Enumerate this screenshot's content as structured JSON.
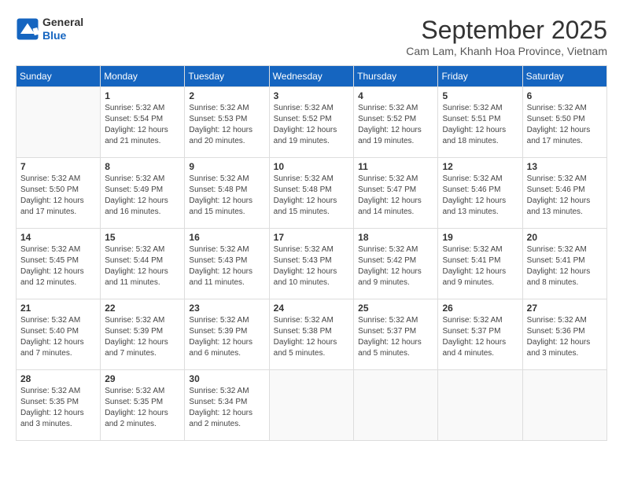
{
  "logo": {
    "line1": "General",
    "line2": "Blue"
  },
  "title": "September 2025",
  "subtitle": "Cam Lam, Khanh Hoa Province, Vietnam",
  "days_of_week": [
    "Sunday",
    "Monday",
    "Tuesday",
    "Wednesday",
    "Thursday",
    "Friday",
    "Saturday"
  ],
  "weeks": [
    [
      {
        "day": null
      },
      {
        "day": 1,
        "sunrise": "5:32 AM",
        "sunset": "5:54 PM",
        "daylight": "12 hours and 21 minutes."
      },
      {
        "day": 2,
        "sunrise": "5:32 AM",
        "sunset": "5:53 PM",
        "daylight": "12 hours and 20 minutes."
      },
      {
        "day": 3,
        "sunrise": "5:32 AM",
        "sunset": "5:52 PM",
        "daylight": "12 hours and 19 minutes."
      },
      {
        "day": 4,
        "sunrise": "5:32 AM",
        "sunset": "5:52 PM",
        "daylight": "12 hours and 19 minutes."
      },
      {
        "day": 5,
        "sunrise": "5:32 AM",
        "sunset": "5:51 PM",
        "daylight": "12 hours and 18 minutes."
      },
      {
        "day": 6,
        "sunrise": "5:32 AM",
        "sunset": "5:50 PM",
        "daylight": "12 hours and 17 minutes."
      }
    ],
    [
      {
        "day": 7,
        "sunrise": "5:32 AM",
        "sunset": "5:50 PM",
        "daylight": "12 hours and 17 minutes."
      },
      {
        "day": 8,
        "sunrise": "5:32 AM",
        "sunset": "5:49 PM",
        "daylight": "12 hours and 16 minutes."
      },
      {
        "day": 9,
        "sunrise": "5:32 AM",
        "sunset": "5:48 PM",
        "daylight": "12 hours and 15 minutes."
      },
      {
        "day": 10,
        "sunrise": "5:32 AM",
        "sunset": "5:48 PM",
        "daylight": "12 hours and 15 minutes."
      },
      {
        "day": 11,
        "sunrise": "5:32 AM",
        "sunset": "5:47 PM",
        "daylight": "12 hours and 14 minutes."
      },
      {
        "day": 12,
        "sunrise": "5:32 AM",
        "sunset": "5:46 PM",
        "daylight": "12 hours and 13 minutes."
      },
      {
        "day": 13,
        "sunrise": "5:32 AM",
        "sunset": "5:46 PM",
        "daylight": "12 hours and 13 minutes."
      }
    ],
    [
      {
        "day": 14,
        "sunrise": "5:32 AM",
        "sunset": "5:45 PM",
        "daylight": "12 hours and 12 minutes."
      },
      {
        "day": 15,
        "sunrise": "5:32 AM",
        "sunset": "5:44 PM",
        "daylight": "12 hours and 11 minutes."
      },
      {
        "day": 16,
        "sunrise": "5:32 AM",
        "sunset": "5:43 PM",
        "daylight": "12 hours and 11 minutes."
      },
      {
        "day": 17,
        "sunrise": "5:32 AM",
        "sunset": "5:43 PM",
        "daylight": "12 hours and 10 minutes."
      },
      {
        "day": 18,
        "sunrise": "5:32 AM",
        "sunset": "5:42 PM",
        "daylight": "12 hours and 9 minutes."
      },
      {
        "day": 19,
        "sunrise": "5:32 AM",
        "sunset": "5:41 PM",
        "daylight": "12 hours and 9 minutes."
      },
      {
        "day": 20,
        "sunrise": "5:32 AM",
        "sunset": "5:41 PM",
        "daylight": "12 hours and 8 minutes."
      }
    ],
    [
      {
        "day": 21,
        "sunrise": "5:32 AM",
        "sunset": "5:40 PM",
        "daylight": "12 hours and 7 minutes."
      },
      {
        "day": 22,
        "sunrise": "5:32 AM",
        "sunset": "5:39 PM",
        "daylight": "12 hours and 7 minutes."
      },
      {
        "day": 23,
        "sunrise": "5:32 AM",
        "sunset": "5:39 PM",
        "daylight": "12 hours and 6 minutes."
      },
      {
        "day": 24,
        "sunrise": "5:32 AM",
        "sunset": "5:38 PM",
        "daylight": "12 hours and 5 minutes."
      },
      {
        "day": 25,
        "sunrise": "5:32 AM",
        "sunset": "5:37 PM",
        "daylight": "12 hours and 5 minutes."
      },
      {
        "day": 26,
        "sunrise": "5:32 AM",
        "sunset": "5:37 PM",
        "daylight": "12 hours and 4 minutes."
      },
      {
        "day": 27,
        "sunrise": "5:32 AM",
        "sunset": "5:36 PM",
        "daylight": "12 hours and 3 minutes."
      }
    ],
    [
      {
        "day": 28,
        "sunrise": "5:32 AM",
        "sunset": "5:35 PM",
        "daylight": "12 hours and 3 minutes."
      },
      {
        "day": 29,
        "sunrise": "5:32 AM",
        "sunset": "5:35 PM",
        "daylight": "12 hours and 2 minutes."
      },
      {
        "day": 30,
        "sunrise": "5:32 AM",
        "sunset": "5:34 PM",
        "daylight": "12 hours and 2 minutes."
      },
      {
        "day": null
      },
      {
        "day": null
      },
      {
        "day": null
      },
      {
        "day": null
      }
    ]
  ]
}
